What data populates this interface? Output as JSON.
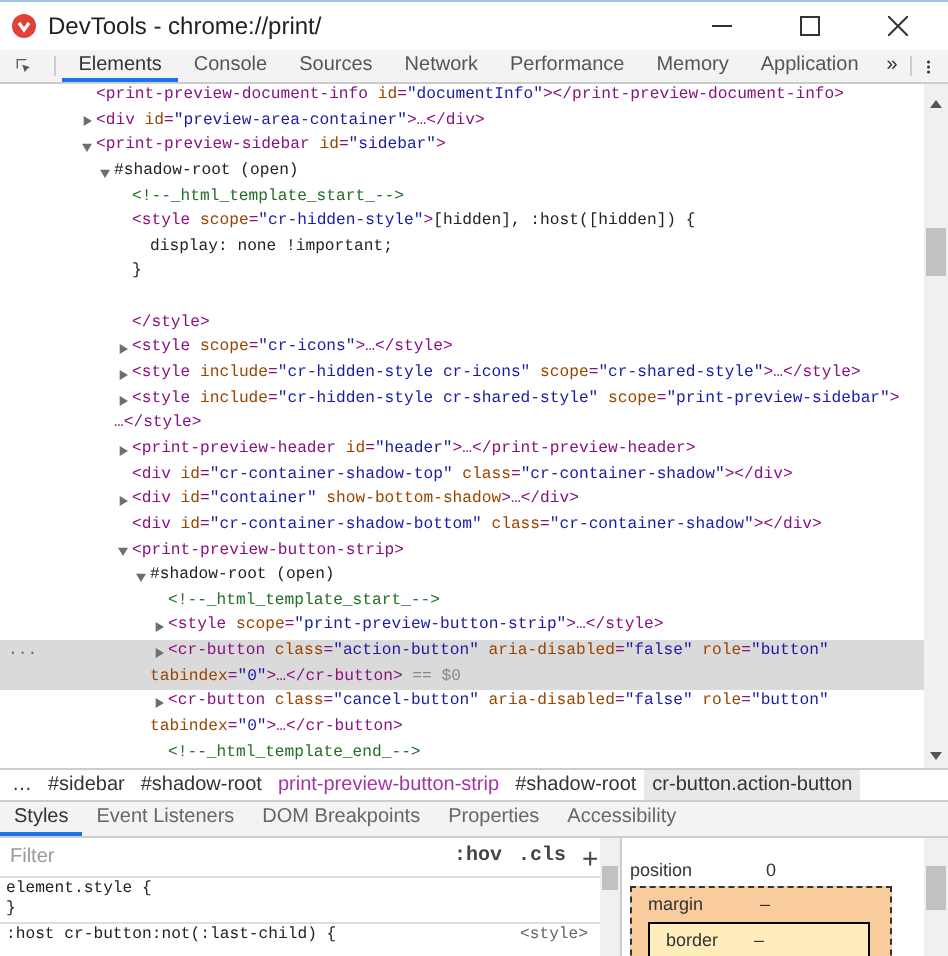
{
  "window": {
    "title": "DevTools - chrome://print/"
  },
  "tabs": [
    {
      "label": "Elements",
      "selected": true
    },
    {
      "label": "Console",
      "selected": false
    },
    {
      "label": "Sources",
      "selected": false
    },
    {
      "label": "Network",
      "selected": false
    },
    {
      "label": "Performance",
      "selected": false
    },
    {
      "label": "Memory",
      "selected": false
    },
    {
      "label": "Application",
      "selected": false
    }
  ],
  "tabs_overflow": "»",
  "dom_tree": [
    {
      "lines": [
        [
          {
            "kind": "tag",
            "text": "<print-preview-document-info"
          },
          {
            "kind": "attr",
            "text": " id"
          },
          {
            "kind": "tag",
            "text": "="
          },
          {
            "kind": "value",
            "text": "\"documentInfo\""
          },
          {
            "kind": "tag",
            "text": "></print-preview-document-info>"
          }
        ]
      ]
    },
    {
      "expanded": false,
      "lines": [
        [
          {
            "kind": "tag",
            "text": "<div"
          },
          {
            "kind": "attr",
            "text": " id"
          },
          {
            "kind": "tag",
            "text": "="
          },
          {
            "kind": "value",
            "text": "\"preview-area-container\""
          },
          {
            "kind": "tag",
            "text": ">…</div>"
          }
        ]
      ]
    },
    {
      "expanded": true,
      "lines": [
        [
          {
            "kind": "tag",
            "text": "<print-preview-sidebar"
          },
          {
            "kind": "attr",
            "text": " id"
          },
          {
            "kind": "tag",
            "text": "="
          },
          {
            "kind": "value",
            "text": "\"sidebar\""
          },
          {
            "kind": "tag",
            "text": ">"
          }
        ]
      ],
      "children": [
        {
          "expanded": true,
          "lines": [
            [
              {
                "kind": "text",
                "text": "#shadow-root (open)"
              }
            ]
          ],
          "children": [
            {
              "lines": [
                [
                  {
                    "kind": "comment",
                    "text": "<!--_html_template_start_-->"
                  }
                ]
              ]
            },
            {
              "lines": [
                [
                  {
                    "kind": "tag",
                    "text": "<style"
                  },
                  {
                    "kind": "attr",
                    "text": " scope"
                  },
                  {
                    "kind": "tag",
                    "text": "="
                  },
                  {
                    "kind": "value",
                    "text": "\"cr-hidden-style\""
                  },
                  {
                    "kind": "tag",
                    "text": ">"
                  },
                  {
                    "kind": "text",
                    "text": "[hidden], :host([hidden]) {"
                  }
                ]
              ],
              "children": [
                {
                  "lines": [
                    [
                      {
                        "kind": "text",
                        "text": "display: none !important;"
                      }
                    ]
                  ]
                }
              ]
            },
            {
              "blank_after": true,
              "lines": [
                [
                  {
                    "kind": "text",
                    "text": "}"
                  }
                ]
              ]
            },
            {
              "lines": [
                [
                  {
                    "kind": "tag",
                    "text": "</style>"
                  }
                ]
              ]
            },
            {
              "expanded": false,
              "lines": [
                [
                  {
                    "kind": "tag",
                    "text": "<style"
                  },
                  {
                    "kind": "attr",
                    "text": " scope"
                  },
                  {
                    "kind": "tag",
                    "text": "="
                  },
                  {
                    "kind": "value",
                    "text": "\"cr-icons\""
                  },
                  {
                    "kind": "tag",
                    "text": ">…</style>"
                  }
                ]
              ]
            },
            {
              "expanded": false,
              "lines": [
                [
                  {
                    "kind": "tag",
                    "text": "<style"
                  },
                  {
                    "kind": "attr",
                    "text": " include"
                  },
                  {
                    "kind": "tag",
                    "text": "="
                  },
                  {
                    "kind": "value",
                    "text": "\"cr-hidden-style cr-icons\""
                  },
                  {
                    "kind": "attr",
                    "text": " scope"
                  },
                  {
                    "kind": "tag",
                    "text": "="
                  },
                  {
                    "kind": "value",
                    "text": "\"cr-shared-style\""
                  },
                  {
                    "kind": "tag",
                    "text": ">…</style>"
                  }
                ]
              ]
            },
            {
              "expanded": false,
              "lines": [
                [
                  {
                    "kind": "tag",
                    "text": "<style"
                  },
                  {
                    "kind": "attr",
                    "text": " include"
                  },
                  {
                    "kind": "tag",
                    "text": "="
                  },
                  {
                    "kind": "value",
                    "text": "\"cr-hidden-style cr-shared-style\""
                  },
                  {
                    "kind": "attr",
                    "text": " scope"
                  },
                  {
                    "kind": "tag",
                    "text": "="
                  },
                  {
                    "kind": "value",
                    "text": "\"print-preview-sidebar\""
                  },
                  {
                    "kind": "tag",
                    "text": ">"
                  }
                ],
                [
                  {
                    "kind": "tag",
                    "text": "…</style>"
                  }
                ]
              ]
            },
            {
              "expanded": false,
              "lines": [
                [
                  {
                    "kind": "tag",
                    "text": "<print-preview-header"
                  },
                  {
                    "kind": "attr",
                    "text": " id"
                  },
                  {
                    "kind": "tag",
                    "text": "="
                  },
                  {
                    "kind": "value",
                    "text": "\"header\""
                  },
                  {
                    "kind": "tag",
                    "text": ">…</print-preview-header>"
                  }
                ]
              ]
            },
            {
              "lines": [
                [
                  {
                    "kind": "tag",
                    "text": "<div"
                  },
                  {
                    "kind": "attr",
                    "text": " id"
                  },
                  {
                    "kind": "tag",
                    "text": "="
                  },
                  {
                    "kind": "value",
                    "text": "\"cr-container-shadow-top\""
                  },
                  {
                    "kind": "attr",
                    "text": " class"
                  },
                  {
                    "kind": "tag",
                    "text": "="
                  },
                  {
                    "kind": "value",
                    "text": "\"cr-container-shadow\""
                  },
                  {
                    "kind": "tag",
                    "text": "></div>"
                  }
                ]
              ]
            },
            {
              "expanded": false,
              "lines": [
                [
                  {
                    "kind": "tag",
                    "text": "<div"
                  },
                  {
                    "kind": "attr",
                    "text": " id"
                  },
                  {
                    "kind": "tag",
                    "text": "="
                  },
                  {
                    "kind": "value",
                    "text": "\"container\""
                  },
                  {
                    "kind": "attr",
                    "text": " show-bottom-shadow"
                  },
                  {
                    "kind": "tag",
                    "text": ">…</div>"
                  }
                ]
              ]
            },
            {
              "lines": [
                [
                  {
                    "kind": "tag",
                    "text": "<div"
                  },
                  {
                    "kind": "attr",
                    "text": " id"
                  },
                  {
                    "kind": "tag",
                    "text": "="
                  },
                  {
                    "kind": "value",
                    "text": "\"cr-container-shadow-bottom\""
                  },
                  {
                    "kind": "attr",
                    "text": " class"
                  },
                  {
                    "kind": "tag",
                    "text": "="
                  },
                  {
                    "kind": "value",
                    "text": "\"cr-container-shadow\""
                  },
                  {
                    "kind": "tag",
                    "text": "></div>"
                  }
                ]
              ]
            },
            {
              "expanded": true,
              "lines": [
                [
                  {
                    "kind": "tag",
                    "text": "<print-preview-button-strip>"
                  }
                ]
              ],
              "children": [
                {
                  "expanded": true,
                  "lines": [
                    [
                      {
                        "kind": "text",
                        "text": "#shadow-root (open)"
                      }
                    ]
                  ],
                  "children": [
                    {
                      "lines": [
                        [
                          {
                            "kind": "comment",
                            "text": "<!--_html_template_start_-->"
                          }
                        ]
                      ]
                    },
                    {
                      "expanded": false,
                      "lines": [
                        [
                          {
                            "kind": "tag",
                            "text": "<style"
                          },
                          {
                            "kind": "attr",
                            "text": " scope"
                          },
                          {
                            "kind": "tag",
                            "text": "="
                          },
                          {
                            "kind": "value",
                            "text": "\"print-preview-button-strip\""
                          },
                          {
                            "kind": "tag",
                            "text": ">…</style>"
                          }
                        ]
                      ]
                    },
                    {
                      "expanded": false,
                      "selected": true,
                      "gutter": "...",
                      "lines": [
                        [
                          {
                            "kind": "tag",
                            "text": "<cr-button"
                          },
                          {
                            "kind": "attr",
                            "text": " class"
                          },
                          {
                            "kind": "tag",
                            "text": "="
                          },
                          {
                            "kind": "value",
                            "text": "\"action-button\""
                          },
                          {
                            "kind": "attr",
                            "text": " aria-disabled"
                          },
                          {
                            "kind": "tag",
                            "text": "="
                          },
                          {
                            "kind": "value",
                            "text": "\"false\""
                          },
                          {
                            "kind": "attr",
                            "text": " role"
                          },
                          {
                            "kind": "tag",
                            "text": "="
                          },
                          {
                            "kind": "value",
                            "text": "\"button\""
                          }
                        ],
                        [
                          {
                            "kind": "attr",
                            "text": "tabindex"
                          },
                          {
                            "kind": "tag",
                            "text": "="
                          },
                          {
                            "kind": "value",
                            "text": "\"0\""
                          },
                          {
                            "kind": "tag",
                            "text": ">…</cr-button>"
                          },
                          {
                            "kind": "dim",
                            "text": " == $0"
                          }
                        ]
                      ]
                    },
                    {
                      "expanded": false,
                      "selected": false,
                      "lines": [
                        [
                          {
                            "kind": "tag",
                            "text": "<cr-button"
                          },
                          {
                            "kind": "attr",
                            "text": " class"
                          },
                          {
                            "kind": "tag",
                            "text": "="
                          },
                          {
                            "kind": "value",
                            "text": "\"cancel-button\""
                          },
                          {
                            "kind": "attr",
                            "text": " aria-disabled"
                          },
                          {
                            "kind": "tag",
                            "text": "="
                          },
                          {
                            "kind": "value",
                            "text": "\"false\""
                          },
                          {
                            "kind": "attr",
                            "text": " role"
                          },
                          {
                            "kind": "tag",
                            "text": "="
                          },
                          {
                            "kind": "value",
                            "text": "\"button\""
                          }
                        ],
                        [
                          {
                            "kind": "attr",
                            "text": "tabindex"
                          },
                          {
                            "kind": "tag",
                            "text": "="
                          },
                          {
                            "kind": "value",
                            "text": "\"0\""
                          },
                          {
                            "kind": "tag",
                            "text": ">…</cr-button>"
                          }
                        ]
                      ]
                    },
                    {
                      "lines": [
                        [
                          {
                            "kind": "comment",
                            "text": "<!--_html_template_end_-->"
                          }
                        ]
                      ]
                    }
                  ]
                }
              ]
            }
          ]
        }
      ]
    }
  ],
  "breadcrumbs": [
    {
      "label": "…",
      "kind": "plain",
      "selected": false
    },
    {
      "label": "#sidebar",
      "kind": "plain",
      "selected": false
    },
    {
      "label": "#shadow-root",
      "kind": "plain",
      "selected": false
    },
    {
      "label": "print-preview-button-strip",
      "kind": "tag",
      "selected": false
    },
    {
      "label": "#shadow-root",
      "kind": "plain",
      "selected": false
    },
    {
      "label": "cr-button.action-button",
      "kind": "plain",
      "selected": true
    }
  ],
  "sub_tabs": [
    {
      "label": "Styles",
      "selected": true
    },
    {
      "label": "Event Listeners",
      "selected": false
    },
    {
      "label": "DOM Breakpoints",
      "selected": false
    },
    {
      "label": "Properties",
      "selected": false
    },
    {
      "label": "Accessibility",
      "selected": false
    }
  ],
  "styles": {
    "filter": {
      "placeholder": "Filter"
    },
    "hov": ":hov",
    "cls": ".cls",
    "add": "+",
    "rules": [
      {
        "selector": "element.style {",
        "close": "}"
      },
      {
        "selector": ":host cr-button:not(:last-child) {",
        "source": "<style>"
      }
    ]
  },
  "box_model": {
    "position_label": "position",
    "position_value": "0",
    "margin_label": "margin",
    "margin_value": "–",
    "border_label": "border",
    "border_value": "–"
  }
}
